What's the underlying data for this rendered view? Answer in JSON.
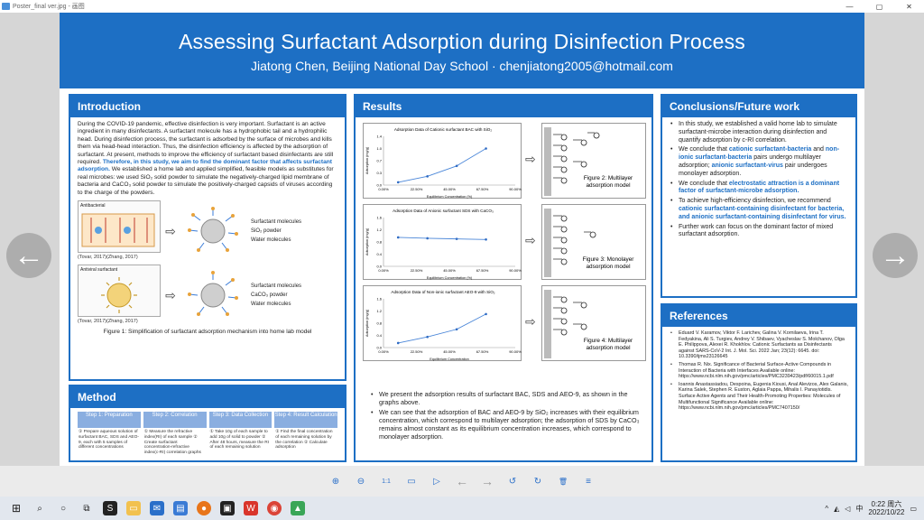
{
  "window": {
    "title": "Poster_final ver.jpg - 画图",
    "minimize": "—",
    "maximize": "▢",
    "close": "✕"
  },
  "poster": {
    "title": "Assessing Surfactant Adsorption during Disinfection Process",
    "subtitle": "Jiatong Chen, Beijing National Day School · chenjiatong2005@hotmail.com",
    "intro": {
      "heading": "Introduction",
      "p1": "During the COVID-19 pandemic, effective disinfection is very important. Surfactant is an active ingredient in many disinfectants. A surfactant molecule has a hydrophobic tail and a hydrophilic head. During disinfection process, the surfactant is adsorbed by the surface of microbes and kills them via head-head interaction. Thus, the disinfection efficiency is affected by the adsorption of surfactant. At present, methods to improve the efficiency of surfactant based disinfectants are still required.",
      "p1_hl": "Therefore, in this study, we aim to find the dominant factor that affects surfactant adsorption.",
      "p2": "We established a home lab and applied simplified, feasible models as substitutes for real microbes: we used SiO₂ solid powder to simulate the negatively-charged lipid membrane of bacteria and CaCO₃ solid powder to simulate the positively-charged capsids of viruses according to the charge of the powders.",
      "fig_a_label": "Antibacterial",
      "fig_a_cite": "(Tovar, 2017)(Zhang, 2017)",
      "fig_a_items": [
        "Surfactant molecules",
        "SiO₂ powder",
        "Water molecules"
      ],
      "fig_b_label": "Antiviral surfactant",
      "fig_b_cite": "(Tovar, 2017)(Zhang, 2017)",
      "fig_b_items": [
        "Surfactant molecules",
        "CaCO₃ powder",
        "Water molecules"
      ],
      "caption": "Figure 1: Simplification of surfactant adsorption mechanism into home lab model"
    },
    "method": {
      "heading": "Method",
      "steps": [
        {
          "title": "Step 1: Preparation",
          "body": "① Prepare aqueous solution of surfactant BAC, SDS and AEO-9, each with 5 samples of different concentrations"
        },
        {
          "title": "Step 2: Correlation",
          "body": "① Measure the refractive index(RI) of each sample ② Create surfactant concentration-refractive index(c-RI) correlation graphs"
        },
        {
          "title": "Step 3: Data Collection",
          "body": "① Take 10g of each sample to add 10g of solid to powder ② After 48 hours, measure the RI of each remaining solution"
        },
        {
          "title": "Step 4: Result Calculation",
          "body": "① Find the final concentration of each remaining solution by the correlation ② Calculate adsorption"
        }
      ]
    },
    "results": {
      "heading": "Results",
      "fig2_caption": "Figure 2: Multilayer adsorption model",
      "fig3_caption": "Figure 3: Monolayer adsorption model",
      "fig4_caption": "Figure 4: Multilayer adsorption model",
      "bullets": [
        "We present the adsorption results of surfactant BAC, SDS and AEO-9, as shown in the graphs above.",
        "We can see that the adsorption of BAC and AEO-9 by SiO₂ increases with their equilibrium concentration, which correspond to multilayer adsorption; the adsorption of SDS by CaCO₃ remains almost constant as its equilibrium concentration increases, which correspond to monolayer adsorption."
      ]
    },
    "conclusions": {
      "heading": "Conclusions/Future work",
      "b1": "In this study, we established a valid home lab to simulate surfactant-microbe interaction during disinfection and quantify adsorption by c-RI correlation.",
      "b2_pre": "We conclude that ",
      "b2_hl1": "cationic surfactant-bacteria",
      "b2_mid": " and ",
      "b2_hl2": "non-ionic surfactant-bacteria",
      "b2_post": " pairs undergo multilayer adsorption; ",
      "b2_hl3": "anionic surfactant-virus",
      "b2_end": " pair undergoes monolayer adsorption.",
      "b3_pre": "We conclude that ",
      "b3_hl": "electrostatic attraction is a dominant factor of surfactant-microbe adsorption.",
      "b4_pre": "To achieve high-efficiency disinfection, we recommend ",
      "b4_hl1": "cationic surfactant-containing disinfectant for bacteria, and anionic surfactant-containing disinfectant for virus.",
      "b5": "Further work can focus on the dominant factor of mixed surfactant adsorption."
    },
    "references": {
      "heading": "References",
      "items": [
        "Eduard V. Karamov, Viktor F. Larichev, Galina V. Kornilaeva, Irina T. Fedyakina, Ali S. Turgiev, Andrey V. Shibaev, Vyacheslav S. Molchanov, Olga E. Philippova, Alexei R. Khokhlov. Cationic Surfactants as Disinfectants against SARS-CoV-2 Int. J. Mol. Sci. 2022 Jan; 23(12): 6645. doi: 10.3390/ijms23126645",
        "Thomas R. Nix. Significance of Bacterial Surface-Active Compounds in Interaction of Bacteria with Interfaces Available online: https://www.ncbi.nlm.nih.gov/pmc/articles/PMC3239423/pdf/60015.1.pdf",
        "Ioannis Anastassiadou, Despoina, Eugenia Kiousi, Anal Alevizos, Alex Galanis, Karina Salek, Stephen R. Euston, Aglaia Pappa, Mihalis I. Panayiotidis. Surface Active Agents and Their Health-Promoting Properties: Molecules of Multifunctional Significance Available online: https://www.ncbi.nlm.nih.gov/pmc/articles/PMC7407150/"
      ]
    }
  },
  "chart_data": [
    {
      "type": "line",
      "title": "Adsorption Data of Cationic surfactant BAC with SiO₂",
      "xlabel": "Equilibrium Concentration (%)",
      "ylabel": "Adsorption (mg/g)",
      "x": [
        0.1,
        0.3,
        0.5,
        0.7
      ],
      "y": [
        0.08,
        0.25,
        0.55,
        1.05
      ],
      "xlim": [
        0,
        0.9
      ],
      "ylim": [
        0,
        1.4
      ]
    },
    {
      "type": "line",
      "title": "Adsorption Data of Anionic surfactant SDS with CaCO₃",
      "xlabel": "Equilibrium Concentration (%)",
      "ylabel": "Adsorption (mg/g)",
      "x": [
        0.1,
        0.3,
        0.5,
        0.7
      ],
      "y": [
        0.95,
        0.92,
        0.9,
        0.88
      ],
      "xlim": [
        0,
        0.9
      ],
      "ylim": [
        0,
        1.6
      ]
    },
    {
      "type": "line",
      "title": "Adsorption Data of Non-ionic surfactant AEO-9 with SiO₂",
      "xlabel": "Equilibrium Concentration",
      "ylabel": "Adsorption (mg/g)",
      "x": [
        0.1,
        0.3,
        0.5,
        0.7
      ],
      "y": [
        0.15,
        0.35,
        0.6,
        1.1
      ],
      "xlim": [
        0,
        0.9
      ],
      "ylim": [
        0,
        1.6
      ]
    }
  ],
  "toolbar": {
    "zoom_in": "⊕",
    "zoom_out": "⊖",
    "actual_size": "1:1",
    "open": "▭",
    "slideshow": "▷",
    "prev": "←",
    "next": "→",
    "rotate_left": "↺",
    "rotate_right": "↻",
    "delete": "🗑",
    "menu": "≡"
  },
  "taskbar": {
    "time": "0:22 周六",
    "date": "2022/10/22",
    "ime": "中"
  }
}
